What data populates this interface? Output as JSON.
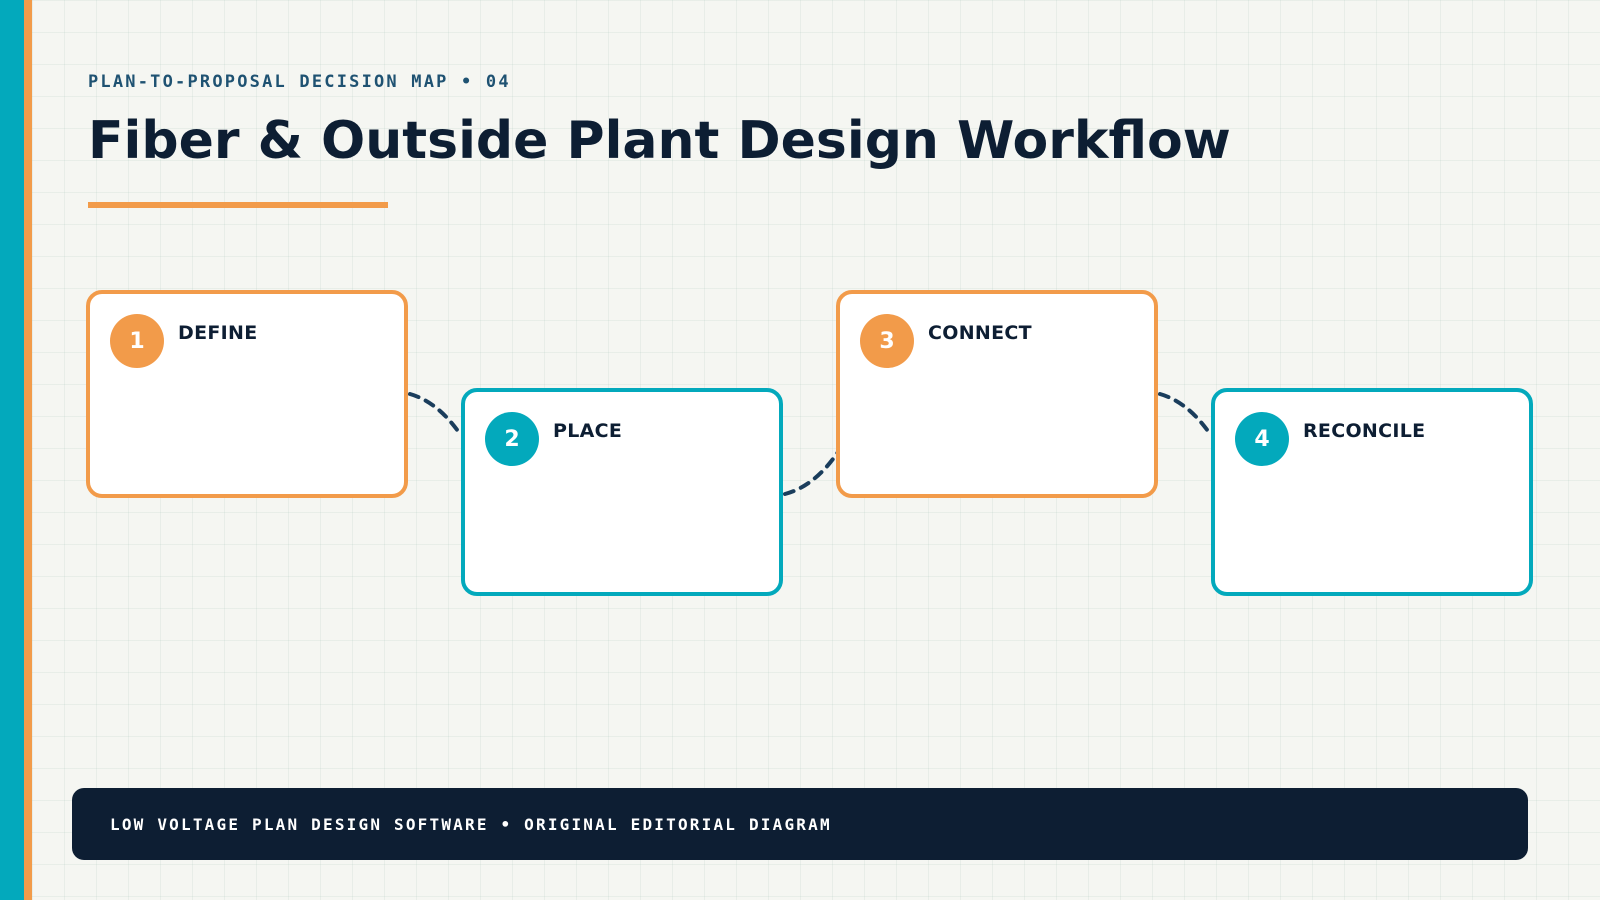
{
  "header": {
    "kicker": "PLAN-TO-PROPOSAL DECISION MAP • 04",
    "title": "Fiber & Outside Plant Design Workflow"
  },
  "steps": [
    {
      "number": "1",
      "label": "DEFINE",
      "accent": "orange"
    },
    {
      "number": "2",
      "label": "PLACE",
      "accent": "teal"
    },
    {
      "number": "3",
      "label": "CONNECT",
      "accent": "orange"
    },
    {
      "number": "4",
      "label": "RECONCILE",
      "accent": "teal"
    }
  ],
  "footer": {
    "text": "LOW VOLTAGE PLAN DESIGN SOFTWARE • ORIGINAL EDITORIAL DIAGRAM"
  },
  "colors": {
    "teal": "#03a9bc",
    "orange": "#f29b4a",
    "navy": "#0d1e33",
    "connector": "#1a3d5c",
    "background": "#f5f6f2"
  }
}
